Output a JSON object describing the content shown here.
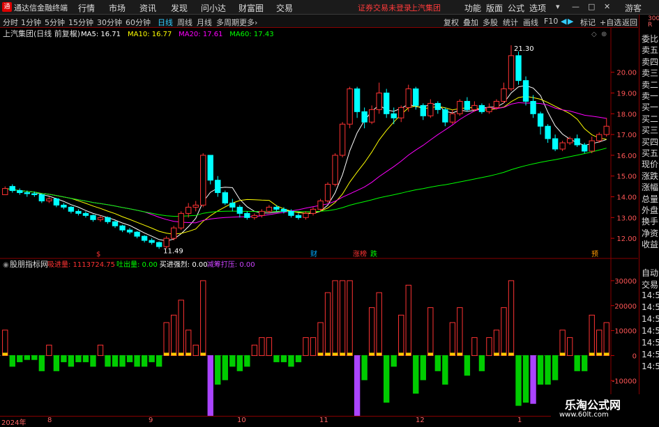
{
  "app": {
    "logo_glyph": "通",
    "title": "通达信金融终端"
  },
  "menu": [
    "行情",
    "市场",
    "资讯",
    "发现",
    "问小达",
    "财富圈",
    "交易"
  ],
  "status": {
    "trade_warning": "证券交易未登录",
    "stock_name": "上汽集团"
  },
  "right_menu": [
    "功能",
    "版面",
    "公式",
    "选项"
  ],
  "user": "游客",
  "window_controls": [
    "▾",
    "—",
    "□",
    "✕"
  ],
  "periods": [
    "分时",
    "1分钟",
    "5分钟",
    "15分钟",
    "30分钟",
    "60分钟",
    "日线",
    "周线",
    "月线",
    "多周期",
    "更多›"
  ],
  "active_period": "日线",
  "tools": [
    "复权",
    "叠加",
    "多股",
    "统计",
    "画线",
    "F10",
    "标记",
    "+自选",
    "返回"
  ],
  "nav_arrows": [
    "◀",
    "▶"
  ],
  "chart_header": {
    "title": "上汽集团(日线 前复权)",
    "ma": [
      {
        "label": "MA5: 16.71",
        "color": "#ffffff"
      },
      {
        "label": "MA10: 16.77",
        "color": "#ffff00"
      },
      {
        "label": "MA20: 17.61",
        "color": "#ff00ff"
      },
      {
        "label": "MA60: 17.43",
        "color": "#00ff00"
      }
    ]
  },
  "indicator_header": {
    "title": "股朋指标网",
    "items": [
      {
        "label": "吸进量: 1113724.75",
        "color": "#ff3333"
      },
      {
        "label": "吐出量: 0.00",
        "color": "#00ff00"
      },
      {
        "label": "买进强烈: 0.00",
        "color": "#ffffff"
      },
      {
        "label": "减筹打压: 0.00",
        "color": "#cc44ff"
      }
    ]
  },
  "price_axis": [
    "20.00",
    "19.00",
    "18.00",
    "17.00",
    "16.00",
    "15.00",
    "14.00",
    "13.00",
    "12.00"
  ],
  "vol_axis": [
    "30000",
    "20000",
    "10000",
    "0",
    "-10000",
    "-20000"
  ],
  "annotations": {
    "high": "21.30",
    "low": "11.49"
  },
  "markers": [
    "$",
    "财",
    "涨榜",
    "跌",
    "预"
  ],
  "date_labels": [
    "2024年",
    "8",
    "9",
    "10",
    "11",
    "12",
    "1"
  ],
  "right_panel": {
    "top": [
      "R",
      "300"
    ],
    "rows": [
      "委比",
      "卖五",
      "卖四",
      "卖三",
      "卖二",
      "卖一",
      "买一",
      "买二",
      "买三",
      "买四",
      "买五",
      "现价",
      "涨跌",
      "涨幅",
      "总量",
      "外盘",
      "换手",
      "净资",
      "收益",
      "自动",
      "交易",
      "14:56",
      "14:56",
      "14:56",
      "14:56",
      "14:56",
      "14:56",
      "14:56"
    ]
  },
  "watermark": {
    "line1": "乐淘公式网",
    "line2": "www.60lt.com"
  },
  "chart_data": {
    "type": "candlestick",
    "price_axis_range": [
      11.4,
      21.4
    ],
    "ohlc": [
      [
        14.1,
        14.4,
        14.1,
        14.5
      ],
      [
        14.5,
        14.3,
        14.2,
        14.6
      ],
      [
        14.3,
        14.2,
        14.1,
        14.4
      ],
      [
        14.2,
        14.15,
        14.0,
        14.3
      ],
      [
        14.15,
        14.1,
        14.0,
        14.25
      ],
      [
        14.1,
        13.8,
        13.7,
        14.15
      ],
      [
        13.8,
        13.9,
        13.7,
        14.0
      ],
      [
        13.9,
        13.6,
        13.5,
        13.95
      ],
      [
        13.6,
        13.5,
        13.4,
        13.7
      ],
      [
        13.5,
        13.3,
        13.2,
        13.55
      ],
      [
        13.3,
        13.2,
        13.1,
        13.4
      ],
      [
        13.2,
        13.1,
        13.0,
        13.3
      ],
      [
        13.1,
        12.9,
        12.8,
        13.15
      ],
      [
        12.9,
        13.0,
        12.8,
        13.1
      ],
      [
        13.0,
        12.8,
        12.7,
        13.05
      ],
      [
        12.8,
        12.6,
        12.5,
        12.85
      ],
      [
        12.6,
        12.4,
        12.3,
        12.65
      ],
      [
        12.4,
        12.3,
        12.2,
        12.5
      ],
      [
        12.3,
        12.1,
        12.0,
        12.35
      ],
      [
        12.1,
        11.9,
        11.8,
        12.15
      ],
      [
        11.9,
        11.8,
        11.7,
        12.0
      ],
      [
        11.8,
        11.6,
        11.49,
        11.85
      ],
      [
        11.6,
        12.0,
        11.5,
        12.1
      ],
      [
        12.0,
        12.5,
        11.9,
        12.6
      ],
      [
        12.5,
        13.2,
        12.4,
        13.3
      ],
      [
        13.2,
        13.5,
        13.0,
        13.7
      ],
      [
        13.5,
        13.6,
        13.3,
        13.8
      ],
      [
        13.6,
        16.0,
        13.5,
        16.1
      ],
      [
        16.0,
        14.8,
        14.6,
        16.0
      ],
      [
        14.8,
        14.2,
        14.0,
        15.0
      ],
      [
        14.2,
        13.7,
        13.6,
        14.3
      ],
      [
        13.7,
        13.5,
        13.3,
        13.9
      ],
      [
        13.5,
        13.2,
        13.0,
        13.6
      ],
      [
        13.2,
        13.0,
        12.9,
        13.3
      ],
      [
        13.0,
        13.1,
        12.9,
        13.2
      ],
      [
        13.1,
        13.3,
        13.0,
        13.4
      ],
      [
        13.3,
        13.5,
        13.2,
        13.6
      ],
      [
        13.5,
        13.4,
        13.3,
        13.6
      ],
      [
        13.4,
        13.3,
        13.2,
        13.5
      ],
      [
        13.3,
        13.1,
        13.0,
        13.4
      ],
      [
        13.1,
        13.0,
        12.9,
        13.2
      ],
      [
        13.0,
        13.2,
        12.9,
        13.3
      ],
      [
        13.2,
        13.4,
        13.1,
        13.5
      ],
      [
        13.4,
        13.8,
        13.3,
        13.9
      ],
      [
        13.8,
        14.6,
        13.7,
        14.7
      ],
      [
        14.6,
        16.0,
        14.5,
        16.1
      ],
      [
        16.0,
        17.5,
        15.9,
        17.6
      ],
      [
        17.5,
        19.2,
        17.3,
        19.3
      ],
      [
        19.2,
        18.1,
        17.8,
        19.3
      ],
      [
        18.1,
        17.6,
        17.3,
        18.3
      ],
      [
        17.6,
        18.2,
        17.5,
        18.4
      ],
      [
        18.2,
        19.0,
        18.0,
        19.5
      ],
      [
        19.0,
        18.0,
        17.8,
        19.2
      ],
      [
        18.0,
        17.8,
        17.5,
        18.3
      ],
      [
        17.8,
        18.3,
        17.6,
        18.4
      ],
      [
        18.3,
        19.2,
        18.1,
        19.4
      ],
      [
        19.2,
        18.4,
        18.2,
        19.3
      ],
      [
        18.4,
        17.9,
        17.7,
        18.5
      ],
      [
        17.9,
        18.5,
        17.8,
        18.7
      ],
      [
        18.5,
        18.2,
        18.0,
        18.6
      ],
      [
        18.2,
        17.6,
        17.4,
        18.3
      ],
      [
        17.6,
        18.0,
        17.5,
        18.2
      ],
      [
        18.0,
        18.6,
        17.9,
        18.7
      ],
      [
        18.6,
        18.2,
        18.1,
        18.8
      ],
      [
        18.2,
        18.4,
        18.1,
        18.6
      ],
      [
        18.4,
        18.1,
        18.0,
        18.5
      ],
      [
        18.1,
        18.3,
        18.0,
        18.5
      ],
      [
        18.3,
        18.6,
        18.2,
        18.7
      ],
      [
        18.6,
        19.2,
        18.5,
        19.5
      ],
      [
        19.2,
        20.8,
        19.1,
        21.3
      ],
      [
        20.8,
        19.6,
        19.4,
        21.0
      ],
      [
        19.6,
        18.6,
        18.4,
        19.8
      ],
      [
        18.6,
        18.0,
        17.8,
        18.9
      ],
      [
        18.0,
        17.4,
        17.0,
        18.1
      ],
      [
        17.4,
        16.8,
        16.6,
        17.5
      ],
      [
        16.8,
        16.3,
        16.2,
        17.0
      ],
      [
        16.3,
        16.6,
        16.2,
        16.7
      ],
      [
        16.6,
        16.8,
        16.5,
        16.9
      ],
      [
        16.8,
        16.5,
        16.4,
        17.0
      ],
      [
        16.5,
        16.2,
        16.1,
        16.6
      ],
      [
        16.2,
        16.7,
        16.1,
        16.9
      ],
      [
        16.7,
        17.0,
        16.6,
        17.1
      ],
      [
        17.0,
        17.4,
        16.9,
        17.8
      ]
    ]
  }
}
